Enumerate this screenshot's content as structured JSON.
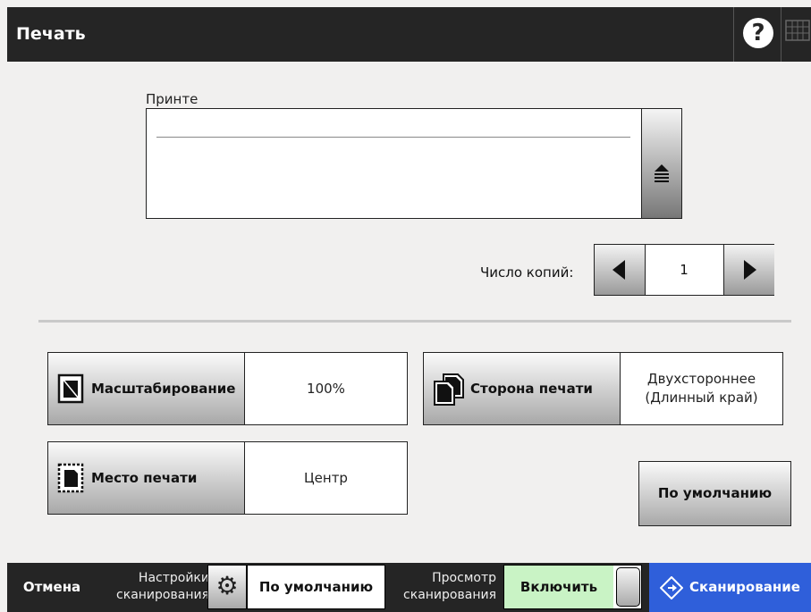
{
  "header": {
    "title": "Печать",
    "help_icon": "question-circle-icon",
    "keyboard_icon": "keyboard-icon"
  },
  "printer": {
    "label": "Принте",
    "value": "",
    "dropdown_icon": "dropdown-list-icon"
  },
  "copies": {
    "label": "Число копий:",
    "value": "1"
  },
  "settings": {
    "scaling": {
      "label": "Масштабирование",
      "value": "100%",
      "icon": "scaling-page-icon"
    },
    "side": {
      "label": "Сторона печати",
      "value_line1": "Двухстороннее",
      "value_line2": "(Длинный край)",
      "icon": "duplex-pages-icon"
    },
    "position": {
      "label": "Место печати",
      "value": "Центр",
      "icon": "print-position-icon"
    },
    "default_label": "По умолчанию"
  },
  "footer": {
    "cancel": "Отмена",
    "scan_settings_line1": "Настройки",
    "scan_settings_line2": "сканирования",
    "profile_value": "По умолчанию",
    "preview_line1": "Просмотр",
    "preview_line2": "сканирования",
    "preview_value": "Включить",
    "scan": "Сканирование"
  },
  "colors": {
    "header_bg": "#252525",
    "page_bg": "#f1f0ef",
    "scan_button": "#2f5fda",
    "toggle_on": "#c9f3c5"
  }
}
